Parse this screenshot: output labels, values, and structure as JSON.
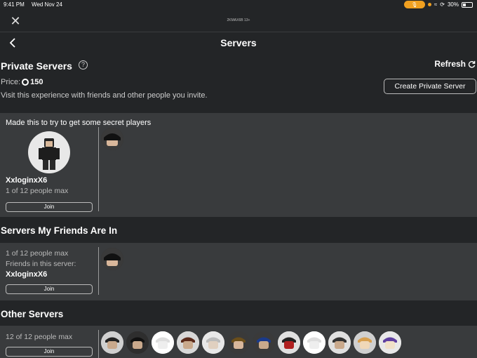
{
  "status_bar": {
    "time": "9:41 PM",
    "date": "Wed Nov 24",
    "battery": "30%",
    "battery_level": 0.3
  },
  "header": {
    "game_tag": "2KMAX6B 13+",
    "title": "Servers"
  },
  "private_servers": {
    "title": "Private Servers",
    "refresh_label": "Refresh",
    "price_label": "Price:",
    "price_value": "150",
    "description": "Visit this experience with friends and other people you invite.",
    "create_button": "Create Private Server",
    "server": {
      "name": "Made this to try to get some secret players",
      "owner": "XxloginxX6",
      "capacity": "1 of 12 people max",
      "join_label": "Join"
    }
  },
  "friends_servers": {
    "title": "Servers My Friends Are In",
    "capacity": "1 of 12 people max",
    "friends_label": "Friends in this server:",
    "friend_name": "XxloginxX6",
    "join_label": "Join"
  },
  "other_servers": {
    "title": "Other Servers",
    "capacity": "12 of 12 people max",
    "join_label": "Join",
    "player_count": 12
  },
  "colors": {
    "accent": "#f0a020",
    "card": "#393b3d",
    "background": "#232527"
  }
}
